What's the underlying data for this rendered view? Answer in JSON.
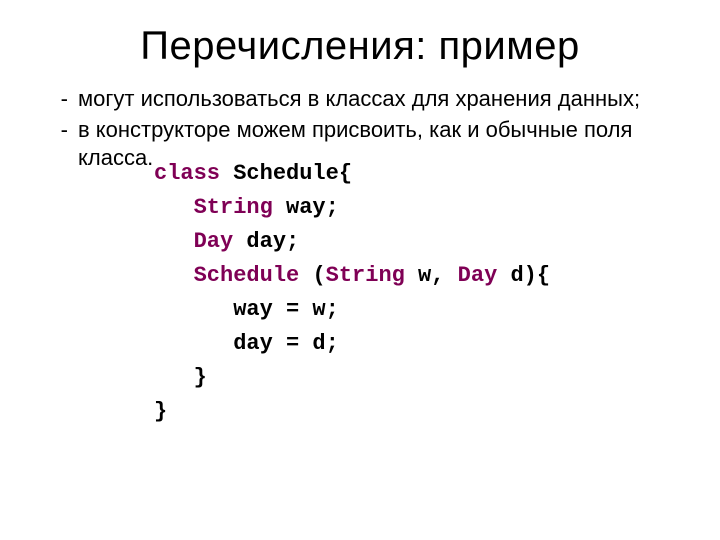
{
  "title": "Перечисления: пример",
  "bullets": [
    "могут использоваться в классах для хранения данных;",
    "в конструкторе можем присвоить, как и обычные поля класса."
  ],
  "code": {
    "l1a": "class",
    "l1b": " Schedule{",
    "l2a": "   String",
    "l2b": " way;",
    "l3a": "   Day",
    "l3b": " day;",
    "l4a": "   Schedule ",
    "l4b": "(",
    "l4c": "String",
    "l4d": " w, ",
    "l4e": "Day",
    "l4f": " d){",
    "l5": "      way = w;",
    "l6": "      day = d;",
    "l7": "   }",
    "l8": "}"
  }
}
